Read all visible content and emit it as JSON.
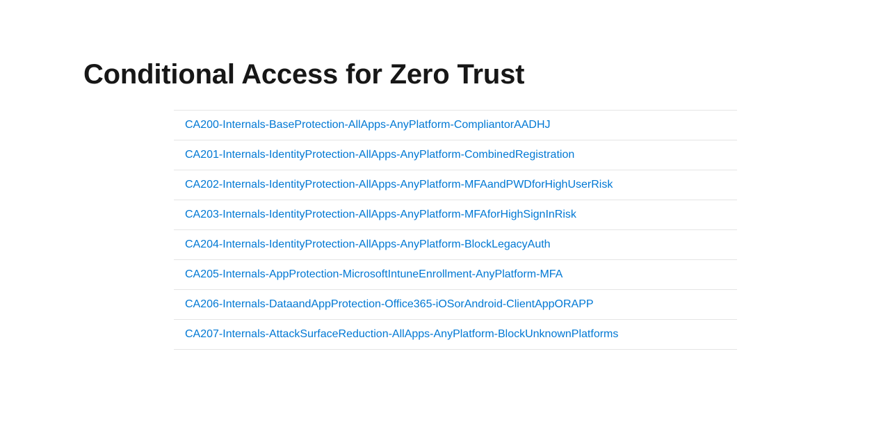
{
  "title": "Conditional Access for Zero Trust",
  "policies": [
    {
      "name": "CA200-Internals-BaseProtection-AllApps-AnyPlatform-CompliantorAADHJ"
    },
    {
      "name": "CA201-Internals-IdentityProtection-AllApps-AnyPlatform-CombinedRegistration"
    },
    {
      "name": "CA202-Internals-IdentityProtection-AllApps-AnyPlatform-MFAandPWDforHighUserRisk"
    },
    {
      "name": "CA203-Internals-IdentityProtection-AllApps-AnyPlatform-MFAforHighSignInRisk"
    },
    {
      "name": "CA204-Internals-IdentityProtection-AllApps-AnyPlatform-BlockLegacyAuth"
    },
    {
      "name": "CA205-Internals-AppProtection-MicrosoftIntuneEnrollment-AnyPlatform-MFA"
    },
    {
      "name": "CA206-Internals-DataandAppProtection-Office365-iOSorAndroid-ClientAppORAPP"
    },
    {
      "name": "CA207-Internals-AttackSurfaceReduction-AllApps-AnyPlatform-BlockUnknownPlatforms"
    }
  ]
}
